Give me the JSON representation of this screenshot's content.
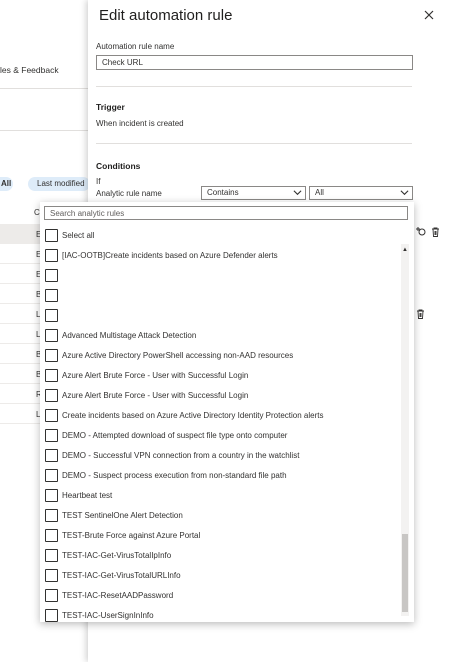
{
  "background": {
    "partial_link": "les & Feedback",
    "filter_all": "All",
    "filter_last_modified": "Last modified",
    "column_header": "C",
    "row_letters": [
      "E",
      "E",
      "E",
      "B",
      "L",
      "L",
      "B",
      "B",
      "R",
      "L"
    ]
  },
  "panel": {
    "title": "Edit automation rule",
    "close_label": "✕",
    "name_label": "Automation rule name",
    "name_value": "Check URL",
    "trigger_heading": "Trigger",
    "trigger_value": "When incident is created",
    "conditions_heading": "Conditions",
    "if_label": "If",
    "property_label": "Analytic rule name",
    "operator_value": "Contains",
    "values_value": "All"
  },
  "popup": {
    "search_placeholder": "Search analytic rules",
    "select_all": "Select all",
    "options": [
      "[IAC-OOTB]Create incidents based on Azure Defender alerts",
      "",
      "",
      "",
      "Advanced Multistage Attack Detection",
      "Azure Active Directory PowerShell accessing non-AAD resources",
      "Azure Alert Brute Force - User with Successful Login",
      "Azure Alert Brute Force - User with Successful Login",
      "Create incidents based on Azure Active Directory Identity Protection alerts",
      "DEMO - Attempted download of suspect file type onto computer",
      "DEMO - Successful VPN connection from a country in the watchlist",
      "DEMO - Suspect process execution from non-standard file path",
      "Heartbeat test",
      "TEST SentinelOne Alert Detection",
      "TEST-Brute Force against Azure Portal",
      "TEST-IAC-Get-VirusTotalIpInfo",
      "TEST-IAC-Get-VirusTotalURLInfo",
      "TEST-IAC-ResetAADPassword",
      "TEST-IAC-UserSignInInfo"
    ]
  },
  "icons": {
    "close": "close-icon",
    "chevron": "chevron-down-icon",
    "scroll_up": "scroll-up-icon",
    "add_action": "add-action-icon",
    "delete": "delete-icon"
  },
  "colors": {
    "accent": "#0078d4",
    "pill_bg": "#deecf9",
    "border": "#8a8886"
  }
}
